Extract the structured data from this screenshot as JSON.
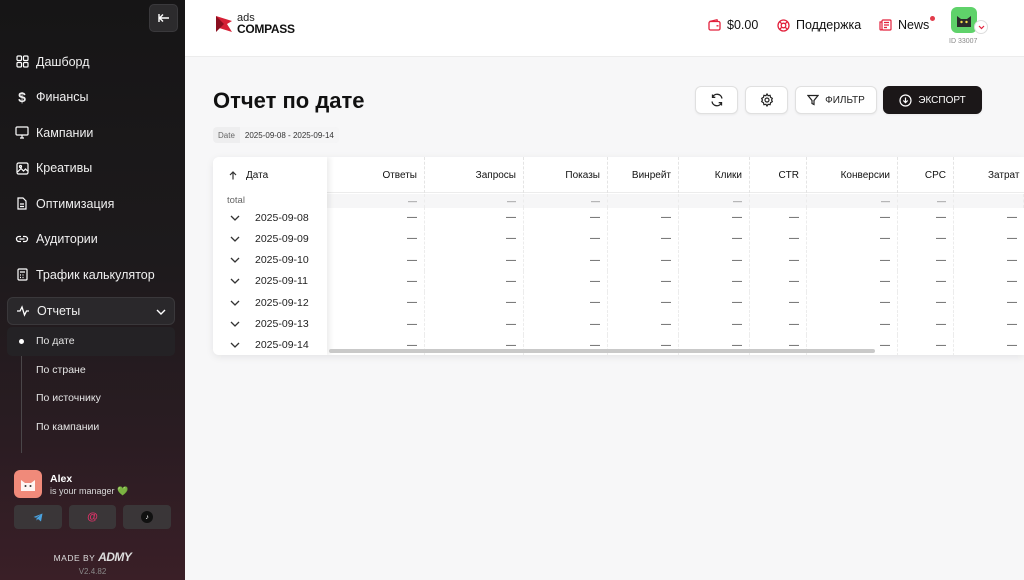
{
  "sidebar": {
    "items": [
      {
        "label": "Дашборд",
        "icon": "dashboard-icon"
      },
      {
        "label": "Финансы",
        "icon": "dollar-icon"
      },
      {
        "label": "Кампании",
        "icon": "monitor-icon"
      },
      {
        "label": "Креативы",
        "icon": "image-icon"
      },
      {
        "label": "Оптимизация",
        "icon": "document-icon"
      },
      {
        "label": "Аудитории",
        "icon": "link-icon"
      },
      {
        "label": "Трафик калькулятор",
        "icon": "calculator-icon"
      },
      {
        "label": "Отчеты",
        "icon": "activity-icon"
      }
    ],
    "subitems": [
      {
        "label": "По дате"
      },
      {
        "label": "По стране"
      },
      {
        "label": "По источнику"
      },
      {
        "label": "По кампании"
      }
    ],
    "manager": {
      "name": "Alex",
      "subtitle": "is your manager 💚"
    },
    "contacts": [
      "telegram-icon",
      "email-icon",
      "tiktok-icon"
    ],
    "made_by_prefix": "MADE BY",
    "made_by_brand": "ADMY",
    "version": "V2.4.82"
  },
  "header": {
    "logo_line1": "ads",
    "logo_line2": "COMPASS",
    "balance": "$0.00",
    "support": "Поддержка",
    "news": "News",
    "user_id": "ID 33007"
  },
  "page": {
    "title": "Отчет по дате",
    "date_label": "Date",
    "date_range": "2025-09-08 - 2025-09-14"
  },
  "toolbar": {
    "filter_label": "ФИЛЬТР",
    "export_label": "ЭКСПОРТ"
  },
  "table": {
    "date_header": "Дата",
    "columns": [
      "Ответы",
      "Запросы",
      "Показы",
      "Винрейт",
      "Клики",
      "CTR",
      "Конверсии",
      "CPC",
      "Затрат"
    ],
    "total_label": "total",
    "total_values": [
      "—",
      "—",
      "—",
      "",
      "—",
      "",
      "—",
      "—",
      ""
    ],
    "rows": [
      {
        "date": "2025-09-08",
        "values": [
          "—",
          "—",
          "—",
          "—",
          "—",
          "—",
          "—",
          "—",
          "—"
        ]
      },
      {
        "date": "2025-09-09",
        "values": [
          "—",
          "—",
          "—",
          "—",
          "—",
          "—",
          "—",
          "—",
          "—"
        ]
      },
      {
        "date": "2025-09-10",
        "values": [
          "—",
          "—",
          "—",
          "—",
          "—",
          "—",
          "—",
          "—",
          "—"
        ]
      },
      {
        "date": "2025-09-11",
        "values": [
          "—",
          "—",
          "—",
          "—",
          "—",
          "—",
          "—",
          "—",
          "—"
        ]
      },
      {
        "date": "2025-09-12",
        "values": [
          "—",
          "—",
          "—",
          "—",
          "—",
          "—",
          "—",
          "—",
          "—"
        ]
      },
      {
        "date": "2025-09-13",
        "values": [
          "—",
          "—",
          "—",
          "—",
          "—",
          "—",
          "—",
          "—",
          "—"
        ]
      },
      {
        "date": "2025-09-14",
        "values": [
          "—",
          "—",
          "—",
          "—",
          "—",
          "—",
          "—",
          "—",
          "—"
        ]
      }
    ]
  },
  "colors": {
    "accent_red": "#e2213c",
    "dark": "#1b1718"
  }
}
